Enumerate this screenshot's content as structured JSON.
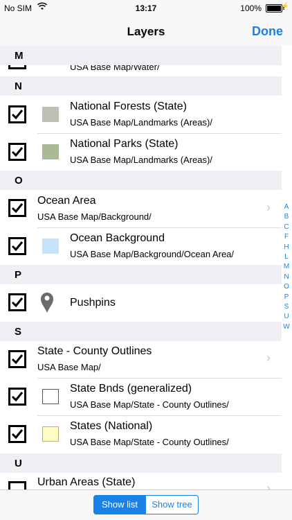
{
  "status_bar": {
    "carrier": "No SIM",
    "time": "13:17",
    "battery": "100%"
  },
  "nav": {
    "title": "Layers",
    "done": "Done"
  },
  "sections": {
    "m": "M",
    "n": "N",
    "o": "O",
    "p": "P",
    "s": "S",
    "u": "U"
  },
  "rows": {
    "water": {
      "subtitle": "USA Base Map/Water/"
    },
    "forests": {
      "title": "National Forests (State)",
      "subtitle": "USA Base Map/Landmarks (Areas)/",
      "color": "#bdc1b4"
    },
    "parks": {
      "title": "National Parks (State)",
      "subtitle": "USA Base Map/Landmarks (Areas)/",
      "color": "#aab993"
    },
    "ocean_area": {
      "title": "Ocean Area",
      "subtitle": "USA Base Map/Background/"
    },
    "ocean_bg": {
      "title": "Ocean Background",
      "subtitle": "USA Base Map/Background/Ocean Area/",
      "color": "#c5e3fa"
    },
    "pushpins": {
      "title": "Pushpins"
    },
    "state_county": {
      "title": "State - County Outlines",
      "subtitle": "USA Base Map/"
    },
    "state_bnds": {
      "title": "State Bnds (generalized)",
      "subtitle": "USA Base Map/State - County Outlines/",
      "color": "#ffffff"
    },
    "states": {
      "title": "States (National)",
      "subtitle": "USA Base Map/State - County Outlines/",
      "color": "#fefbc6"
    },
    "urban": {
      "title": "Urban Areas (State)"
    }
  },
  "index_letters": [
    "A",
    "B",
    "C",
    "F",
    "H",
    "L",
    "M",
    "N",
    "O",
    "P",
    "S",
    "U",
    "W"
  ],
  "bottom": {
    "show_list": "Show list",
    "show_tree": "Show tree"
  },
  "colors": {
    "accent": "#1a82e6"
  }
}
